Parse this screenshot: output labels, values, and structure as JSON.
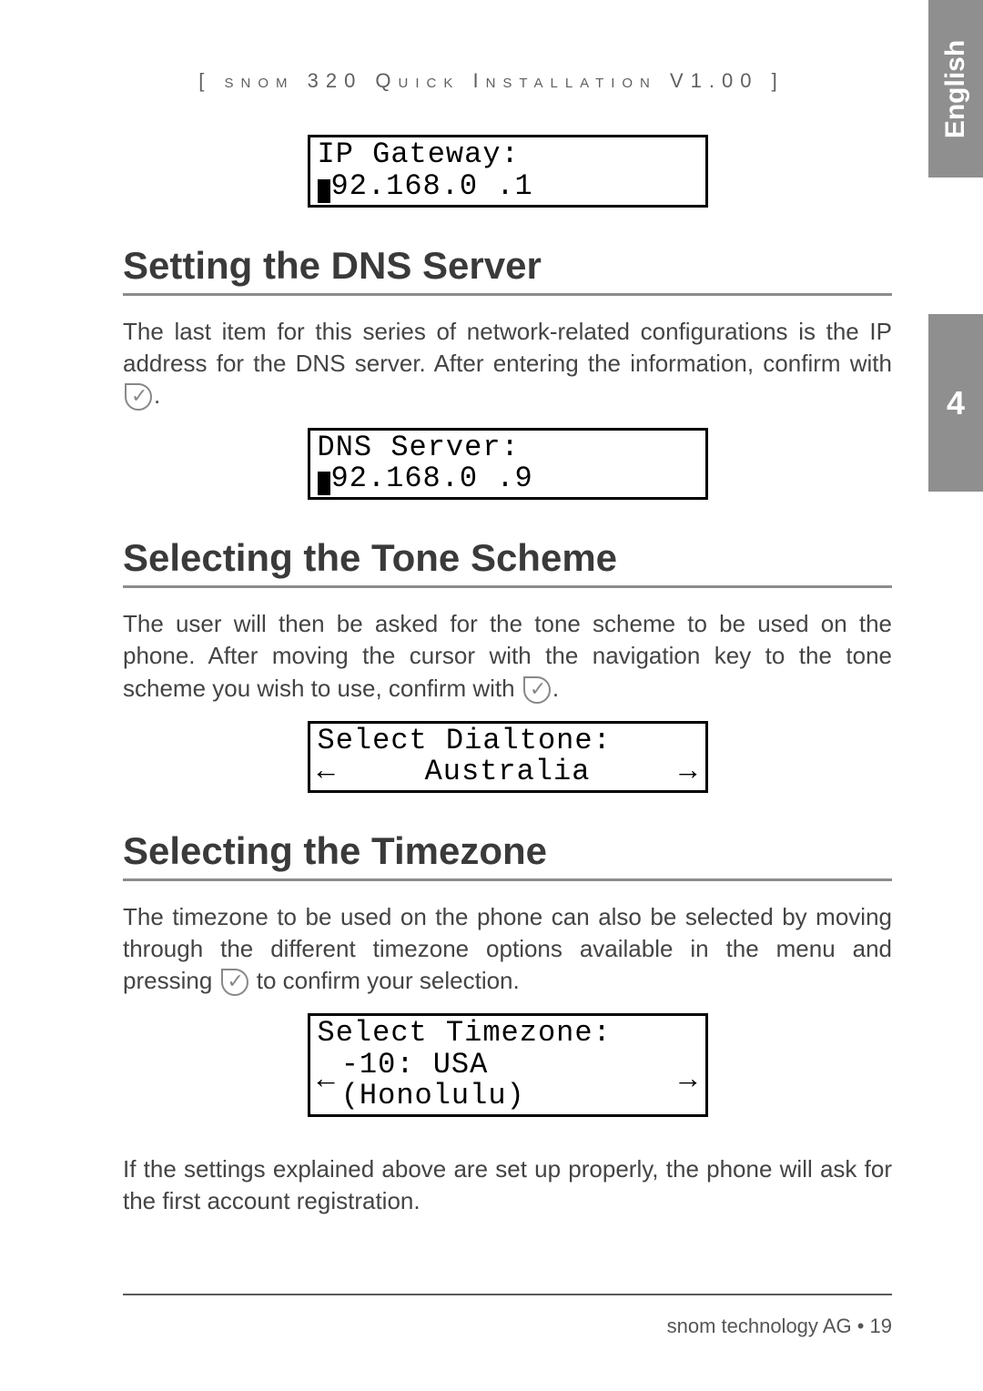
{
  "side": {
    "language": "English",
    "chapter": "4"
  },
  "running_head": "[ snom 320 Quick Installation V1.00 ]",
  "lcd_gateway": {
    "line1": "IP Gateway:",
    "line2_after": "92.168.0  .1"
  },
  "sections": {
    "dns": {
      "heading": "Setting the DNS Server",
      "body": "The last item for this series of network-related configurations is the IP address for the DNS server.  After entering the information, confirm with ",
      "body_after": ".",
      "lcd": {
        "line1": "DNS Server:",
        "line2_after": "92.168.0  .9"
      }
    },
    "tone": {
      "heading": "Selecting the Tone Scheme",
      "body": "The user will then be asked for the tone scheme to be used on the phone.  After moving the cursor with the navigation key to the tone scheme you wish to use, confirm with ",
      "body_after": ".",
      "lcd": {
        "line1": "Select Dialtone:",
        "left": "←",
        "value": "Australia",
        "right": "→"
      }
    },
    "tz": {
      "heading": "Selecting the Timezone",
      "body": "The timezone to be used on the phone can also be selected by moving through the different timezone options available in the menu and pressing ",
      "body_after": " to confirm your selection.",
      "lcd": {
        "line1": "Select Timezone:",
        "left": "←",
        "value": " -10: USA (Honolulu)",
        "right": "→"
      },
      "closing": "If the settings explained above are set up properly, the phone will ask for the first account registration."
    }
  },
  "footer": {
    "text": "snom technology AG   •   19"
  }
}
